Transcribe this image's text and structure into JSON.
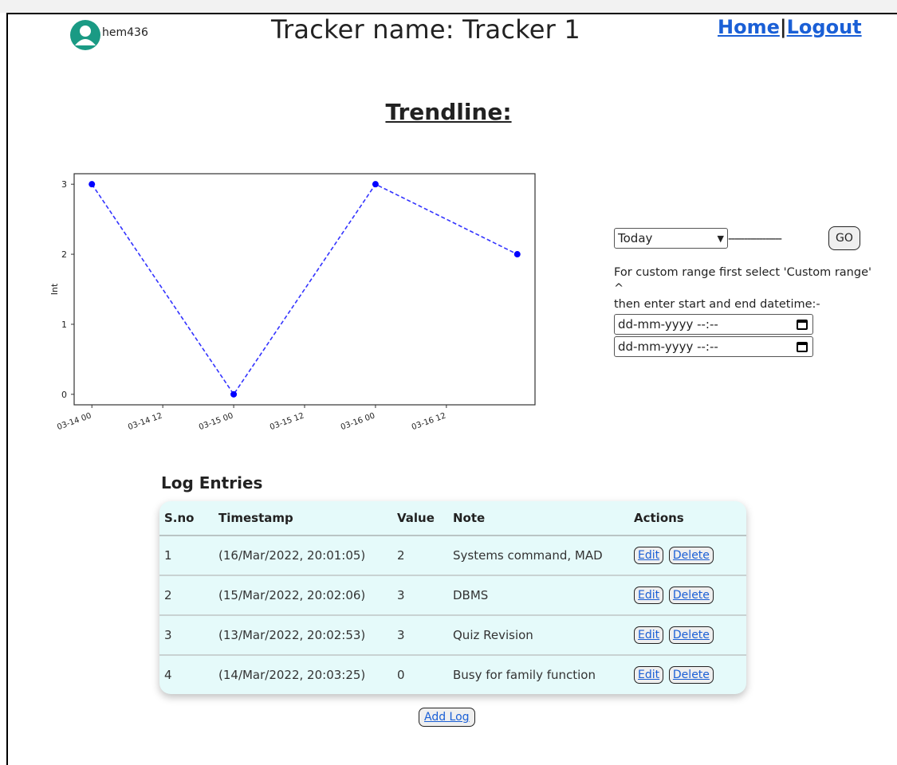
{
  "header": {
    "username": "hem436",
    "title": "Tracker name: Tracker 1",
    "nav": {
      "home": "Home",
      "separator": "|",
      "logout": "Logout"
    }
  },
  "trend_heading": "Trendline:",
  "chart_data": {
    "type": "line",
    "ylabel": "Int",
    "xlabel": "",
    "x": [
      "2022-03-14 00:00",
      "2022-03-15 00:00",
      "2022-03-16 00:00",
      "2022-03-17 00:00"
    ],
    "values": [
      3,
      0,
      3,
      2
    ],
    "x_ticks": [
      "03-14 00",
      "03-14 12",
      "03-15 00",
      "03-15 12",
      "03-16 00",
      "03-16 12"
    ],
    "y_ticks": [
      "0",
      "1",
      "2",
      "3"
    ],
    "ylim": [
      0,
      3
    ],
    "line_style": "dashed",
    "color": "#3333ff",
    "grid": false
  },
  "controls": {
    "range_selected": "Today",
    "dashes": "-----------------",
    "go_label": "GO",
    "hint_line1": "For custom range first select 'Custom range'",
    "hint_caret": "^",
    "hint_line2": "then enter start and end datetime:-",
    "start_placeholder": "dd-mm-yyyy --:--",
    "end_placeholder": "dd-mm-yyyy --:--"
  },
  "log": {
    "heading": "Log Entries",
    "columns": [
      "S.no",
      "Timestamp",
      "Value",
      "Note",
      "Actions"
    ],
    "rows": [
      {
        "sno": "1",
        "timestamp": "(16/Mar/2022, 20:01:05)",
        "value": "2",
        "note": "Systems command, MAD"
      },
      {
        "sno": "2",
        "timestamp": "(15/Mar/2022, 20:02:06)",
        "value": "3",
        "note": "DBMS"
      },
      {
        "sno": "3",
        "timestamp": "(13/Mar/2022, 20:02:53)",
        "value": "3",
        "note": "Quiz Revision"
      },
      {
        "sno": "4",
        "timestamp": "(14/Mar/2022, 20:03:25)",
        "value": "0",
        "note": "Busy for family function"
      }
    ],
    "edit_label": "Edit",
    "delete_label": "Delete",
    "add_label": "Add Log"
  },
  "colors": {
    "avatar": "#1a9a84",
    "link": "#1a5fd6",
    "table_bg": "#e5fafa"
  }
}
